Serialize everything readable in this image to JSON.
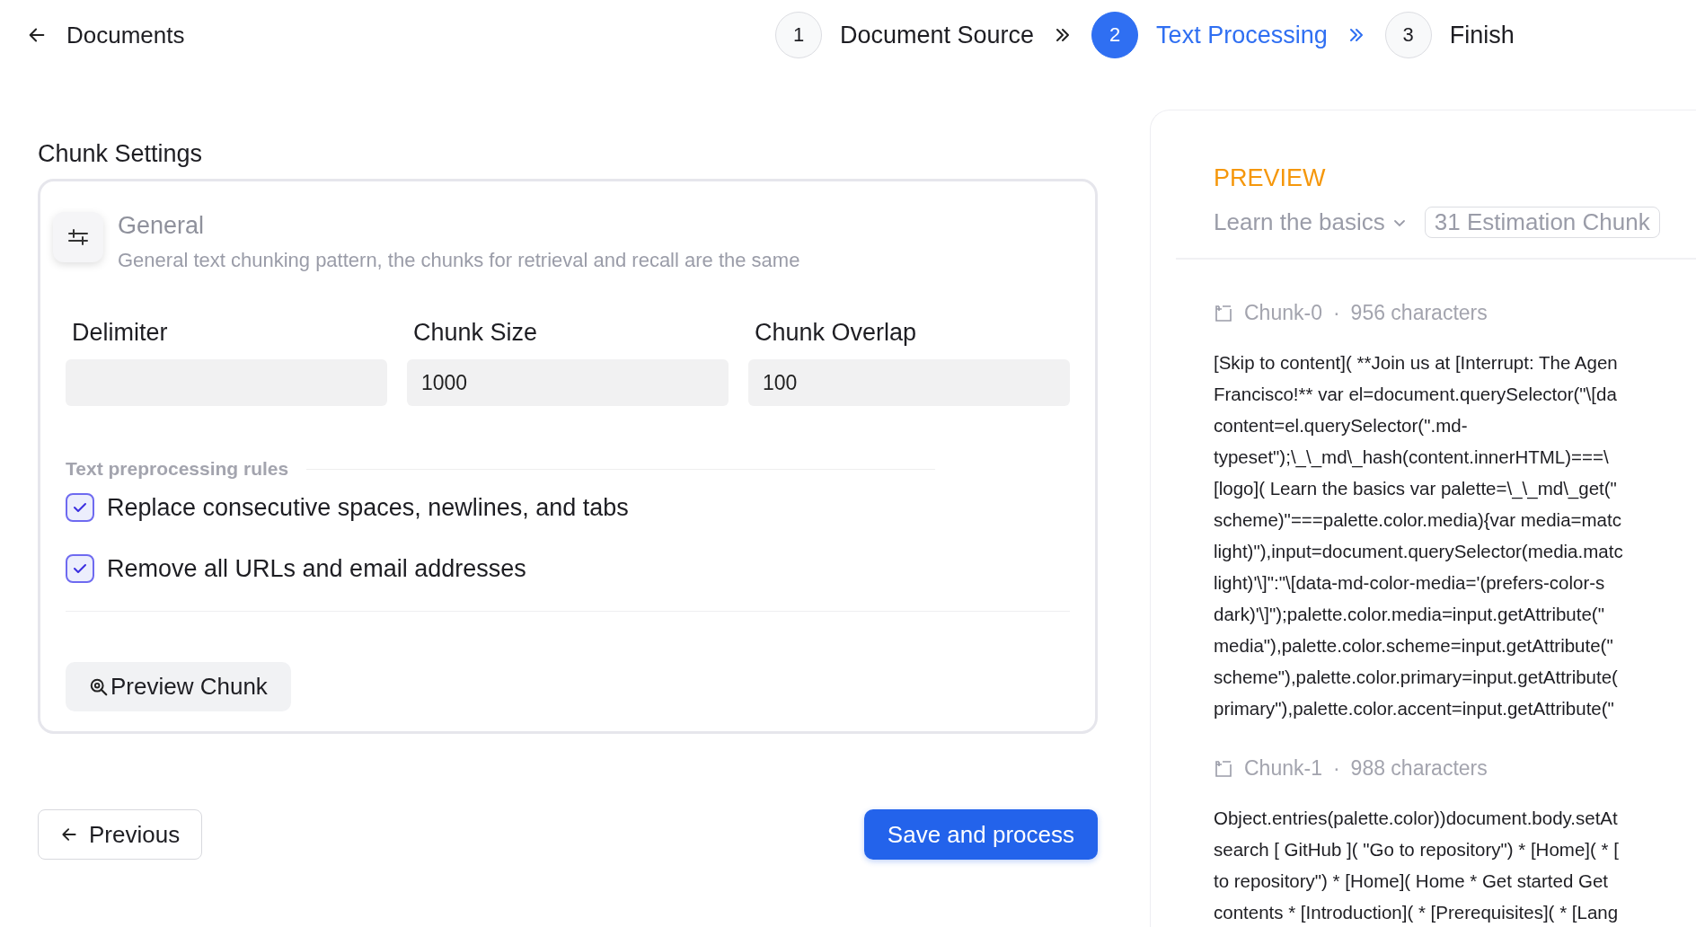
{
  "header": {
    "back_label": "Documents"
  },
  "steps": [
    {
      "number": "1",
      "label": "Document Source",
      "selected": false
    },
    {
      "number": "2",
      "label": "Text Processing",
      "selected": true
    },
    {
      "number": "3",
      "label": "Finish",
      "selected": false
    }
  ],
  "chunk_settings": {
    "title": "Chunk Settings",
    "mode": {
      "name": "General",
      "description": "General text chunking pattern, the chunks for retrieval and recall are the same"
    },
    "fields": [
      {
        "label": "Delimiter"
      },
      {
        "label": "Chunk Size",
        "value": "1000"
      },
      {
        "label": "Chunk Overlap",
        "value": "100"
      }
    ],
    "rules": {
      "title": "Text preprocessing rules",
      "items": [
        {
          "label": "Replace consecutive spaces, newlines, and tabs",
          "checked": true
        },
        {
          "label": "Remove all URLs and email addresses",
          "checked": true
        }
      ]
    },
    "preview_button": "Preview Chunk"
  },
  "footer": {
    "previous": "Previous",
    "save": "Save and process"
  },
  "preview": {
    "title": "PREVIEW",
    "document": "Learn the basics",
    "estimate": "31 Estimation Chunk",
    "chunks": [
      {
        "name": "Chunk-0",
        "separator": "·",
        "characters": "956 characters",
        "lines": [
          "[Skip to content]( **Join us at [Interrupt: The Agen",
          "Francisco!** var el=document.querySelector(\"\\[da",
          "content=el.querySelector(\".md-",
          "typeset\");\\_\\_md\\_hash(content.innerHTML)===\\",
          "[logo]( Learn the basics var palette=\\_\\_md\\_get(\"",
          "scheme)\"===palette.color.media){var media=matc",
          "light)\"),input=document.querySelector(media.matc",
          "light)'\\]\":\"\\[data-md-color-media='(prefers-color-s",
          "dark)'\\]\");palette.color.media=input.getAttribute(\"",
          "media\"),palette.color.scheme=input.getAttribute(\"",
          "scheme\"),palette.color.primary=input.getAttribute(",
          "primary\"),palette.color.accent=input.getAttribute(\""
        ]
      },
      {
        "name": "Chunk-1",
        "separator": "·",
        "characters": "988 characters",
        "lines": [
          "Object.entries(palette.color))document.body.setAt",
          "search [ GitHub ]( \"Go to repository\") * [Home]( * [",
          "to repository\") * [Home]( Home * Get started Get",
          "contents * [Introduction]( * [Prerequisites]( * [Lang"
        ]
      }
    ]
  }
}
